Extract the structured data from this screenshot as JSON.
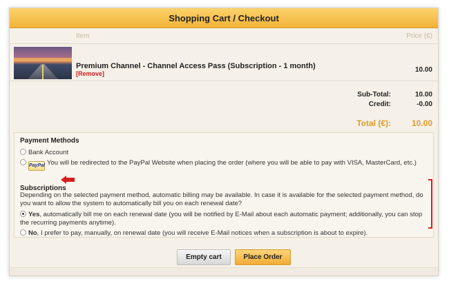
{
  "header": {
    "title": "Shopping Cart / Checkout"
  },
  "table": {
    "col_item": "Item",
    "col_price": "Price (€)",
    "items": [
      {
        "name": "Premium Channel - Channel Access Pass (Subscription - 1 month)",
        "remove_label": "[Remove]",
        "price": "10.00"
      }
    ]
  },
  "totals": {
    "subtotal_label": "Sub-Total:",
    "subtotal_value": "10.00",
    "credit_label": "Credit:",
    "credit_value": "-0.00",
    "total_label": "Total (€):",
    "total_value": "10.00"
  },
  "payment": {
    "title": "Payment Methods",
    "bank_label": "Bank Account",
    "paypal_badge": "PayPal",
    "paypal_label": "You will be redirected to the PayPal Website when placing the order (where you will be able to pay with VISA, MasterCard, etc.)"
  },
  "subscriptions": {
    "title": "Subscriptions",
    "description": "Depending on the selected payment method, automatic billing may be available. In case it is available for the selected payment method, do you want to allow the system to automatically bill you on each renewal date?",
    "yes_bold": "Yes",
    "yes_text": ", automatically bill me on each renewal date (you will be notified by E-Mail about each automatic payment; additionally, you can stop the recurring payments anytime).",
    "no_bold": "No",
    "no_text": ", I prefer to pay, manually, on renewal date (you will receive E-Mail notices when a subscription is about to expire)."
  },
  "actions": {
    "empty_label": "Empty cart",
    "order_label": "Place Order"
  },
  "colors": {
    "accent": "#f2b33a",
    "total": "#e09a2c",
    "remove": "#cc1e1e",
    "annotation": "#d81e1e"
  }
}
